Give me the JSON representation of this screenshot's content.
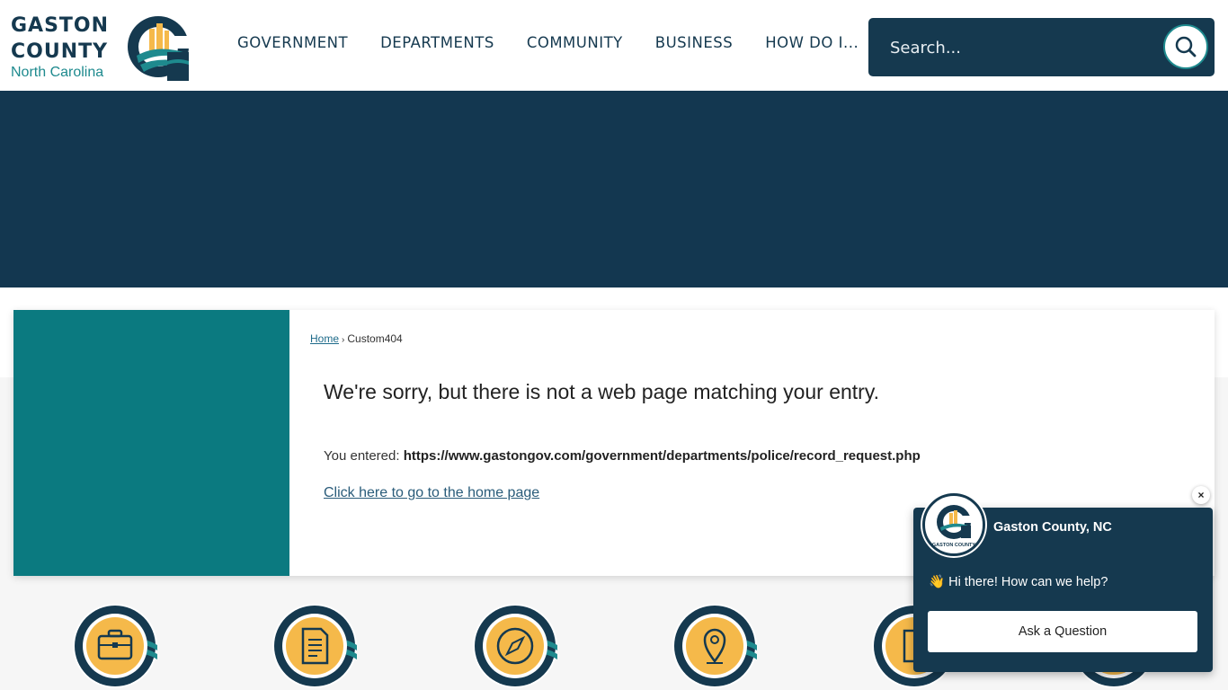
{
  "header": {
    "logo": {
      "line1": "GASTON",
      "line2": "COUNTY",
      "line3": "North Carolina",
      "mark_text": "GASTON COUNTY"
    },
    "nav": [
      {
        "label": "GOVERNMENT"
      },
      {
        "label": "DEPARTMENTS"
      },
      {
        "label": "COMMUNITY"
      },
      {
        "label": "BUSINESS"
      },
      {
        "label": "HOW DO I..."
      }
    ],
    "search": {
      "placeholder": "Search...",
      "icon": "search-icon"
    }
  },
  "breadcrumb": {
    "home": "Home",
    "separator": "›",
    "current": "Custom404"
  },
  "content": {
    "sorry": "We're sorry, but there is not a web page matching your entry.",
    "entered_label": "You entered:",
    "entered_url": "https://www.gastongov.com/government/departments/police/record_request.php",
    "home_link": "Click here to go to the home page"
  },
  "quick_links": [
    {
      "icon": "briefcase-icon"
    },
    {
      "icon": "document-icon"
    },
    {
      "icon": "compass-icon"
    },
    {
      "icon": "map-pin-icon"
    },
    {
      "icon": "scroll-icon"
    },
    {
      "icon": "partial-icon"
    }
  ],
  "chat": {
    "close": "×",
    "org_name": "Gaston County, NC",
    "greeting_emoji": "👋",
    "greeting": "Hi there! How can we help?",
    "button": "Ask a Question",
    "avatar_text": "GASTON COUNTY"
  },
  "colors": {
    "navy": "#15394f",
    "banner": "#133750",
    "teal": "#0b7a80",
    "accent_teal": "#1e8a8e",
    "gold": "#f5b94a"
  }
}
